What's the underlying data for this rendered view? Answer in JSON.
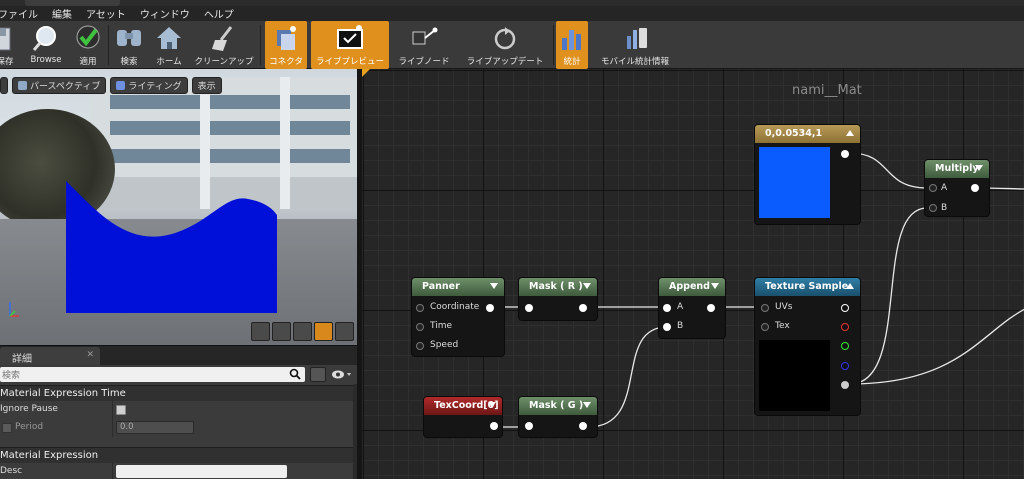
{
  "menu": [
    "ファイル",
    "編集",
    "アセット",
    "ウィンドウ",
    "ヘルプ"
  ],
  "toolbar": [
    {
      "label": "保存",
      "icon": "save-icon"
    },
    {
      "label": "Browse",
      "icon": "browse-icon"
    },
    {
      "label": "適用",
      "icon": "apply-checkmark-icon"
    },
    {
      "label": "検索",
      "icon": "binoculars-icon"
    },
    {
      "label": "ホーム",
      "icon": "home-icon"
    },
    {
      "label": "クリーンアップ",
      "icon": "broom-icon"
    },
    {
      "label": "コネクタ",
      "icon": "connector-icon",
      "active": true
    },
    {
      "label": "ライブプレビュー",
      "icon": "live-preview-icon",
      "active": true
    },
    {
      "label": "ライブノード",
      "icon": "live-node-icon"
    },
    {
      "label": "ライブアップデート",
      "icon": "live-update-icon"
    },
    {
      "label": "統計",
      "icon": "stats-icon",
      "active": true
    },
    {
      "label": "モバイル統計情報",
      "icon": "mobile-stats-icon"
    }
  ],
  "viewport": {
    "perspective": "パースペクティブ",
    "lighting": "ライティング",
    "show": "表示"
  },
  "details": {
    "tab": "詳細",
    "search_placeholder": "検索",
    "category1": "Material Expression Time",
    "ignore_pause": "Ignore Pause",
    "period": "Period",
    "period_value": "0.0",
    "category2": "Material Expression",
    "desc": "Desc"
  },
  "graph": {
    "title": "nami__Mat",
    "constant_node": "0,0.0534,1",
    "multiply": {
      "title": "Multiply",
      "a": "A",
      "b": "B"
    },
    "panner": {
      "title": "Panner",
      "coordinate": "Coordinate",
      "time": "Time",
      "speed": "Speed"
    },
    "mask_r": "Mask ( R )",
    "mask_g": "Mask ( G )",
    "append": {
      "title": "Append",
      "a": "A",
      "b": "B"
    },
    "texture": {
      "title": "Texture Sample",
      "uvs": "UVs",
      "tex": "Tex"
    },
    "texcoord": "TexCoord[0]"
  },
  "colors": {
    "accent": "#e0901d",
    "constant_blue": "#0a5cff",
    "preview_wave": "#0010d8"
  }
}
